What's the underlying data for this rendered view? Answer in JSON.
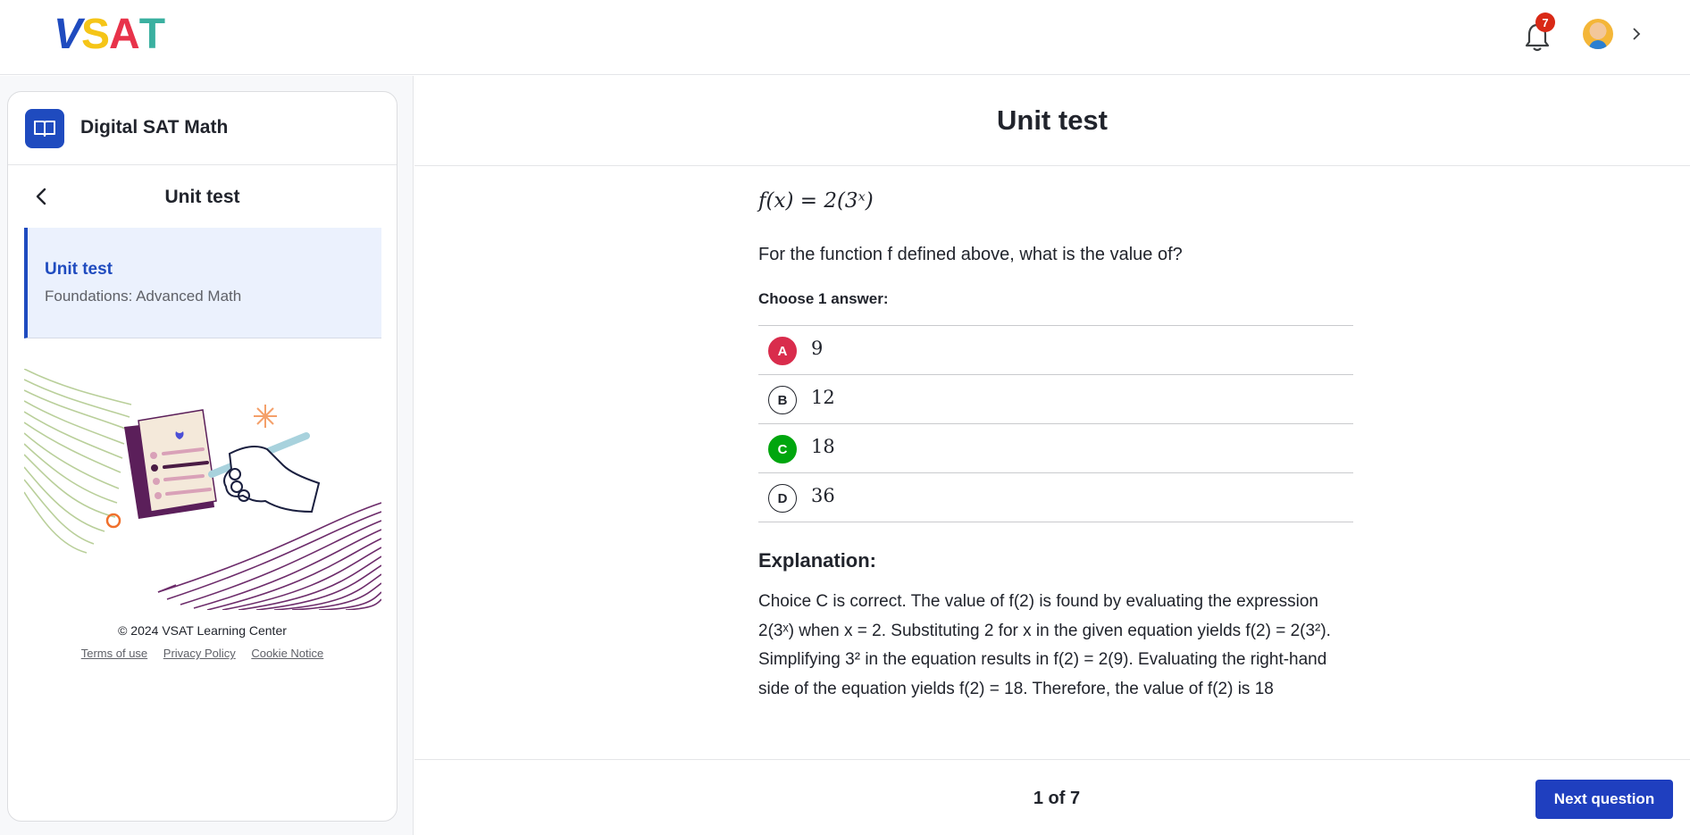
{
  "brand": {
    "logo_text": "VSAT",
    "logo_colors": [
      "#1f4bbf",
      "#f5c518",
      "#e8334a",
      "#3ab0a0"
    ]
  },
  "header": {
    "notification_count": "7",
    "icons": [
      "bell-icon",
      "avatar",
      "chevron-right-icon"
    ]
  },
  "sidebar": {
    "course_title": "Digital SAT Math",
    "section_title": "Unit test",
    "active_item": {
      "title": "Unit test",
      "subtitle": "Foundations: Advanced Math"
    },
    "copyright": "© 2024 VSAT Learning Center",
    "footer_links": [
      "Terms of use",
      "Privacy Policy",
      "Cookie Notice"
    ]
  },
  "main": {
    "title": "Unit test",
    "question": {
      "formula": "f(x) = 2(3ˣ)",
      "prompt": "For the function f defined above, what is the value of?",
      "choose_label": "Choose 1 answer:",
      "choices": [
        {
          "letter": "A",
          "value": "9",
          "state": "incorrect-selected"
        },
        {
          "letter": "B",
          "value": "12",
          "state": "default"
        },
        {
          "letter": "C",
          "value": "18",
          "state": "correct"
        },
        {
          "letter": "D",
          "value": "36",
          "state": "default"
        }
      ]
    },
    "explanation": {
      "title": "Explanation:",
      "text": "Choice C is correct. The value of f(2) is found by evaluating the expression 2(3ˣ) when x = 2. Substituting 2 for x in the given equation yields f(2) = 2(3²). Simplifying 3² in the equation results in f(2) = 2(9). Evaluating the right-hand side of the equation yields f(2) = 18. Therefore, the value of f(2) is 18"
    }
  },
  "footer": {
    "progress": "1 of 7",
    "next_label": "Next question"
  },
  "colors": {
    "accent": "#1f4bbf",
    "incorrect": "#d92c4c",
    "correct": "#00a60e",
    "badge": "#d92916"
  }
}
